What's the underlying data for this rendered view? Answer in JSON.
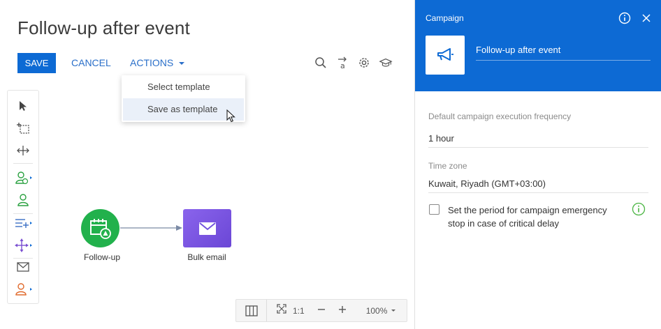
{
  "page": {
    "title": "Follow-up after event"
  },
  "toolbar": {
    "save_label": "SAVE",
    "cancel_label": "CANCEL",
    "actions_label": "ACTIONS"
  },
  "actions_menu": {
    "items": [
      {
        "label": "Select template"
      },
      {
        "label": "Save as template"
      }
    ]
  },
  "canvas": {
    "nodes": [
      {
        "label": "Follow-up",
        "color": "#22b14c"
      },
      {
        "label": "Bulk email",
        "color": "#7a5ae0"
      }
    ]
  },
  "zoom": {
    "ratio_label": "1:1",
    "level": "100%"
  },
  "panel": {
    "header_title": "Campaign",
    "campaign_name": "Follow-up after event",
    "accent_color": "#0d6ad4",
    "fields": [
      {
        "label": "Default campaign execution frequency",
        "value": "1 hour"
      },
      {
        "label": "Time zone",
        "value": "Kuwait, Riyadh (GMT+03:00)"
      }
    ],
    "checkbox": {
      "label": "Set the period for campaign emergency stop in case of critical delay",
      "checked": false
    }
  }
}
